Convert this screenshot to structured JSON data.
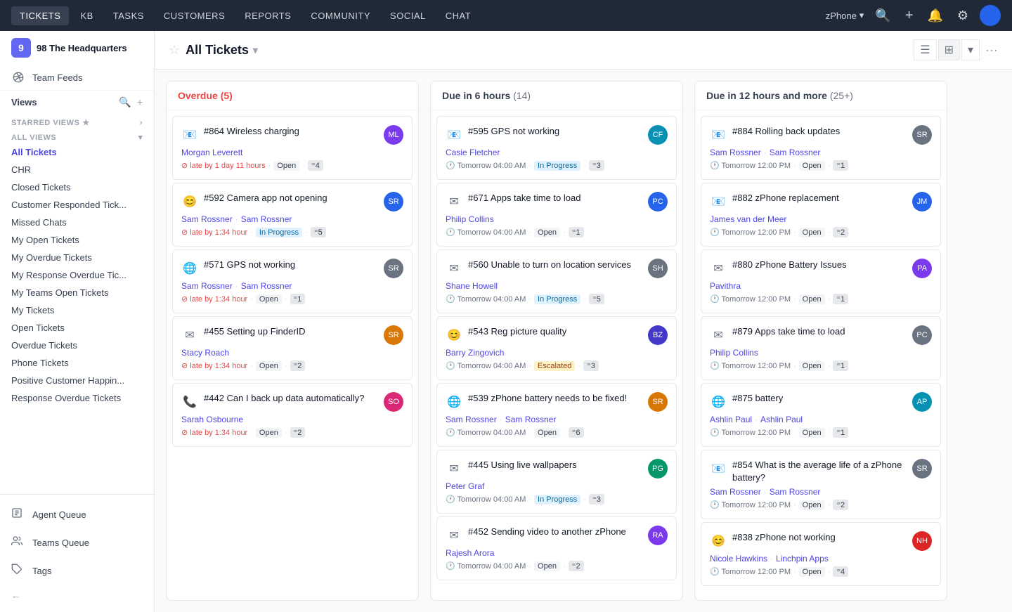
{
  "nav": {
    "items": [
      {
        "label": "TICKETS",
        "active": true
      },
      {
        "label": "KB",
        "active": false
      },
      {
        "label": "TASKS",
        "active": false
      },
      {
        "label": "CUSTOMERS",
        "active": false
      },
      {
        "label": "REPORTS",
        "active": false
      },
      {
        "label": "COMMUNITY",
        "active": false
      },
      {
        "label": "SOCIAL",
        "active": false
      },
      {
        "label": "CHAT",
        "active": false
      }
    ],
    "zphone_label": "zPhone",
    "search_label": "🔍",
    "add_label": "+",
    "notification_label": "🔔",
    "settings_label": "⚙"
  },
  "sidebar": {
    "org": {
      "name": "98 The Headquarters",
      "initial": "9"
    },
    "team_feeds": "Team Feeds",
    "views_label": "Views",
    "starred_label": "STARRED VIEWS ★",
    "all_views_label": "ALL VIEWS",
    "nav_items": [
      {
        "label": "All Tickets",
        "active": true
      },
      {
        "label": "CHR",
        "active": false
      },
      {
        "label": "Closed Tickets",
        "active": false
      },
      {
        "label": "Customer Responded Tick...",
        "active": false
      },
      {
        "label": "Missed Chats",
        "active": false
      },
      {
        "label": "My Open Tickets",
        "active": false
      },
      {
        "label": "My Overdue Tickets",
        "active": false
      },
      {
        "label": "My Response Overdue Tic...",
        "active": false
      },
      {
        "label": "My Teams Open Tickets",
        "active": false
      },
      {
        "label": "My Tickets",
        "active": false
      },
      {
        "label": "Open Tickets",
        "active": false
      },
      {
        "label": "Overdue Tickets",
        "active": false
      },
      {
        "label": "Phone Tickets",
        "active": false
      },
      {
        "label": "Positive Customer Happin...",
        "active": false
      },
      {
        "label": "Response Overdue Tickets",
        "active": false
      }
    ],
    "agent_queue": "Agent Queue",
    "teams_queue": "Teams Queue",
    "tags": "Tags",
    "collapse_label": "←"
  },
  "header": {
    "title": "All Tickets",
    "star_label": "☆"
  },
  "columns": [
    {
      "id": "overdue",
      "label": "Overdue",
      "count": 5,
      "color": "overdue",
      "cards": [
        {
          "id": "#864",
          "title": "#864 Wireless charging",
          "agents": [
            "Morgan Leverett"
          ],
          "meta": "late by 1 day 11 hours",
          "status": "Open",
          "replies": "4",
          "avatar_color": "av-purple",
          "avatar_initial": "ML",
          "icon": "📧",
          "icon_color": "#10b981"
        },
        {
          "id": "#592",
          "title": "#592 Camera app not opening",
          "agents": [
            "Sam Rossner",
            "Sam Rossner"
          ],
          "meta": "late by 1:34 hour",
          "status": "In Progress",
          "replies": "5",
          "avatar_color": "av-blue",
          "avatar_initial": "SR",
          "icon": "😊",
          "icon_color": "#10b981"
        },
        {
          "id": "#571",
          "title": "#571 GPS not working",
          "agents": [
            "Sam Rossner",
            "Sam Rossner"
          ],
          "meta": "late by 1:34 hour",
          "status": "Open",
          "replies": "1",
          "avatar_color": "av-gray",
          "avatar_initial": "SR",
          "icon": "🌐",
          "icon_color": "#6b7280"
        },
        {
          "id": "#455",
          "title": "#455 Setting up FinderID",
          "agents": [
            "Stacy Roach"
          ],
          "meta": "late by 1:34 hour",
          "status": "Open",
          "replies": "2",
          "avatar_color": "av-orange",
          "avatar_initial": "SR",
          "icon": "✉",
          "icon_color": "#6b7280"
        },
        {
          "id": "#442",
          "title": "#442 Can I back up data automatically?",
          "agents": [
            "Sarah Osbourne"
          ],
          "meta": "late by 1:34 hour",
          "status": "Open",
          "replies": "2",
          "avatar_color": "av-pink",
          "avatar_initial": "SO",
          "icon": "📞",
          "icon_color": "#6b7280"
        }
      ]
    },
    {
      "id": "due6",
      "label": "Due in 6 hours",
      "count": 14,
      "color": "normal",
      "cards": [
        {
          "id": "#595",
          "title": "#595 GPS not working",
          "agents": [
            "Casie Fletcher"
          ],
          "meta": "Tomorrow 04:00 AM",
          "status": "In Progress",
          "replies": "3",
          "avatar_color": "av-teal",
          "avatar_initial": "CF",
          "icon": "📧",
          "icon_color": "#10b981"
        },
        {
          "id": "#671",
          "title": "#671 Apps take time to load",
          "agents": [
            "Philip Collins"
          ],
          "meta": "Tomorrow 04:00 AM",
          "status": "Open",
          "replies": "1",
          "avatar_color": "av-blue",
          "avatar_initial": "PC",
          "icon": "✉",
          "icon_color": "#6b7280"
        },
        {
          "id": "#560",
          "title": "#560 Unable to turn on location services",
          "agents": [
            "Shane Howell"
          ],
          "meta": "Tomorrow 04:00 AM",
          "status": "In Progress",
          "replies": "5",
          "avatar_color": "av-gray",
          "avatar_initial": "SH",
          "icon": "✉",
          "icon_color": "#6b7280"
        },
        {
          "id": "#543",
          "title": "#543 Reg picture quality",
          "agents": [
            "Barry Zingovich"
          ],
          "meta": "Tomorrow 04:00 AM",
          "status": "Escalated",
          "replies": "3",
          "avatar_color": "av-indigo",
          "avatar_initial": "BZ",
          "icon": "😊",
          "icon_color": "#10b981"
        },
        {
          "id": "#539",
          "title": "#539 zPhone battery needs to be fixed!",
          "agents": [
            "Sam Rossner",
            "Sam Rossner"
          ],
          "meta": "Tomorrow 04:00 AM",
          "status": "Open",
          "replies": "6",
          "avatar_color": "av-orange",
          "avatar_initial": "SR",
          "icon": "🌐",
          "icon_color": "#6b7280"
        },
        {
          "id": "#445",
          "title": "#445 Using live wallpapers",
          "agents": [
            "Peter Graf"
          ],
          "meta": "Tomorrow 04:00 AM",
          "status": "In Progress",
          "replies": "3",
          "avatar_color": "av-green",
          "avatar_initial": "PG",
          "icon": "✉",
          "icon_color": "#6b7280"
        },
        {
          "id": "#452",
          "title": "#452 Sending video to another zPhone",
          "agents": [
            "Rajesh Arora"
          ],
          "meta": "Tomorrow 04:00 AM",
          "status": "Open",
          "replies": "2",
          "avatar_color": "av-purple",
          "avatar_initial": "RA",
          "icon": "✉",
          "icon_color": "#6b7280"
        }
      ]
    },
    {
      "id": "due12",
      "label": "Due in 12 hours and more",
      "count_label": "25+",
      "color": "normal",
      "cards": [
        {
          "id": "#884",
          "title": "#884 Rolling back updates",
          "agents": [
            "Sam Rossner",
            "Sam Rossner"
          ],
          "meta": "Tomorrow 12:00 PM",
          "status": "Open",
          "replies": "1",
          "avatar_color": "av-gray",
          "avatar_initial": "SR",
          "icon": "📧",
          "icon_color": "#10b981"
        },
        {
          "id": "#882",
          "title": "#882 zPhone replacement",
          "agents": [
            "James van der Meer"
          ],
          "meta": "Tomorrow 12:00 PM",
          "status": "Open",
          "replies": "2",
          "avatar_color": "av-blue",
          "avatar_initial": "JM",
          "icon": "📧",
          "icon_color": "#10b981"
        },
        {
          "id": "#880",
          "title": "#880 zPhone Battery Issues",
          "agents": [
            "Pavithra"
          ],
          "meta": "Tomorrow 12:00 PM",
          "status": "Open",
          "replies": "1",
          "avatar_color": "av-purple",
          "avatar_initial": "PA",
          "icon": "✉",
          "icon_color": "#6b7280"
        },
        {
          "id": "#879",
          "title": "#879 Apps take time to load",
          "agents": [
            "Philip Collins"
          ],
          "meta": "Tomorrow 12:00 PM",
          "status": "Open",
          "replies": "1",
          "avatar_color": "av-gray",
          "avatar_initial": "PC",
          "icon": "✉",
          "icon_color": "#6b7280"
        },
        {
          "id": "#875",
          "title": "#875 battery",
          "agents": [
            "Ashlin Paul",
            "Ashlin Paul"
          ],
          "meta": "Tomorrow 12:00 PM",
          "status": "Open",
          "replies": "1",
          "avatar_color": "av-teal",
          "avatar_initial": "AP",
          "icon": "🌐",
          "icon_color": "#6b7280"
        },
        {
          "id": "#854",
          "title": "#854 What is the average life of a zPhone battery?",
          "agents": [
            "Sam Rossner",
            "Sam Rossner"
          ],
          "meta": "Tomorrow 12:00 PM",
          "status": "Open",
          "replies": "2",
          "avatar_color": "av-gray",
          "avatar_initial": "SR",
          "icon": "📧",
          "icon_color": "#10b981"
        },
        {
          "id": "#838",
          "title": "#838 zPhone not working",
          "agents": [
            "Nicole Hawkins",
            "Linchpin Apps"
          ],
          "meta": "Tomorrow 12:00 PM",
          "status": "Open",
          "replies": "4",
          "avatar_color": "av-red",
          "avatar_initial": "NH",
          "icon": "😊",
          "icon_color": "#10b981"
        }
      ]
    }
  ]
}
